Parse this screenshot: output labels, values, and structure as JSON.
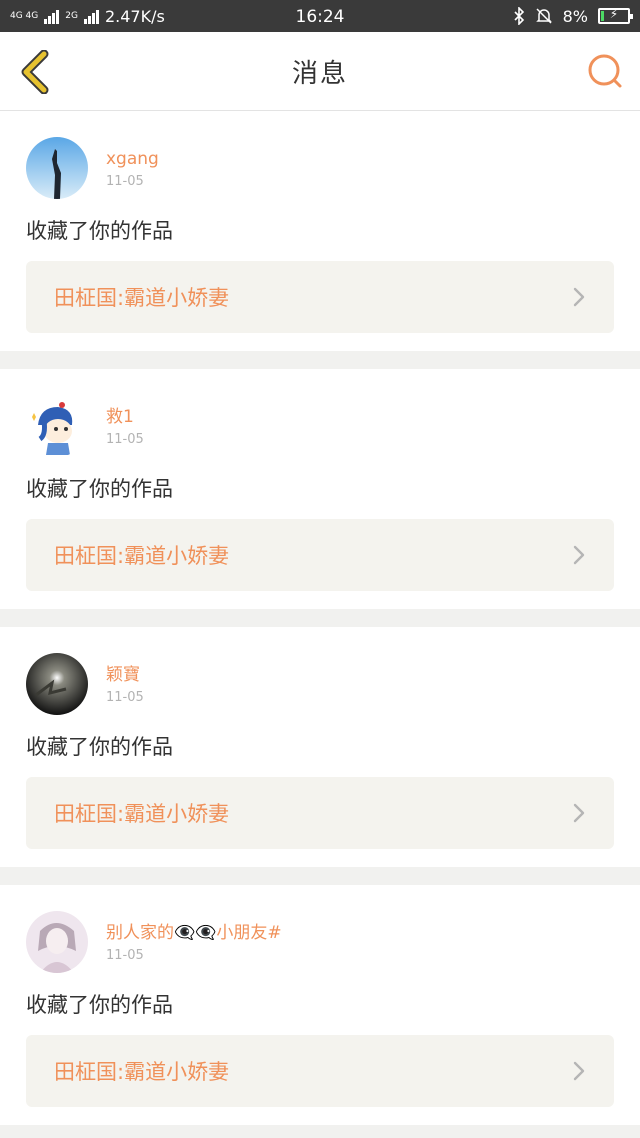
{
  "status_bar": {
    "network_tag_1": "4G 4G",
    "network_tag_2": "2G",
    "speed": "2.47K/s",
    "time": "16:24",
    "battery": "8%",
    "icons": [
      "signal-icon",
      "bluetooth-icon",
      "mute-bell-icon",
      "battery-charging-icon"
    ]
  },
  "header": {
    "title": "消息",
    "back_icon": "chevron-left-icon",
    "search_icon": "search-icon",
    "accent_color": "#f0915a",
    "back_color": "#e3b92a"
  },
  "messages": [
    {
      "user": "xgang",
      "date": "11-05",
      "action": "收藏了你的作品",
      "work": "田柾国:霸道小娇妻"
    },
    {
      "user": "救1",
      "date": "11-05",
      "action": "收藏了你的作品",
      "work": "田柾国:霸道小娇妻"
    },
    {
      "user": "颖寶",
      "date": "11-05",
      "action": "收藏了你的作品",
      "work": "田柾国:霸道小娇妻"
    },
    {
      "user": "别人家的👁‍🗨👁‍🗨小朋友#",
      "date": "11-05",
      "action": "收藏了你的作品",
      "work": "田柾国:霸道小娇妻"
    }
  ]
}
